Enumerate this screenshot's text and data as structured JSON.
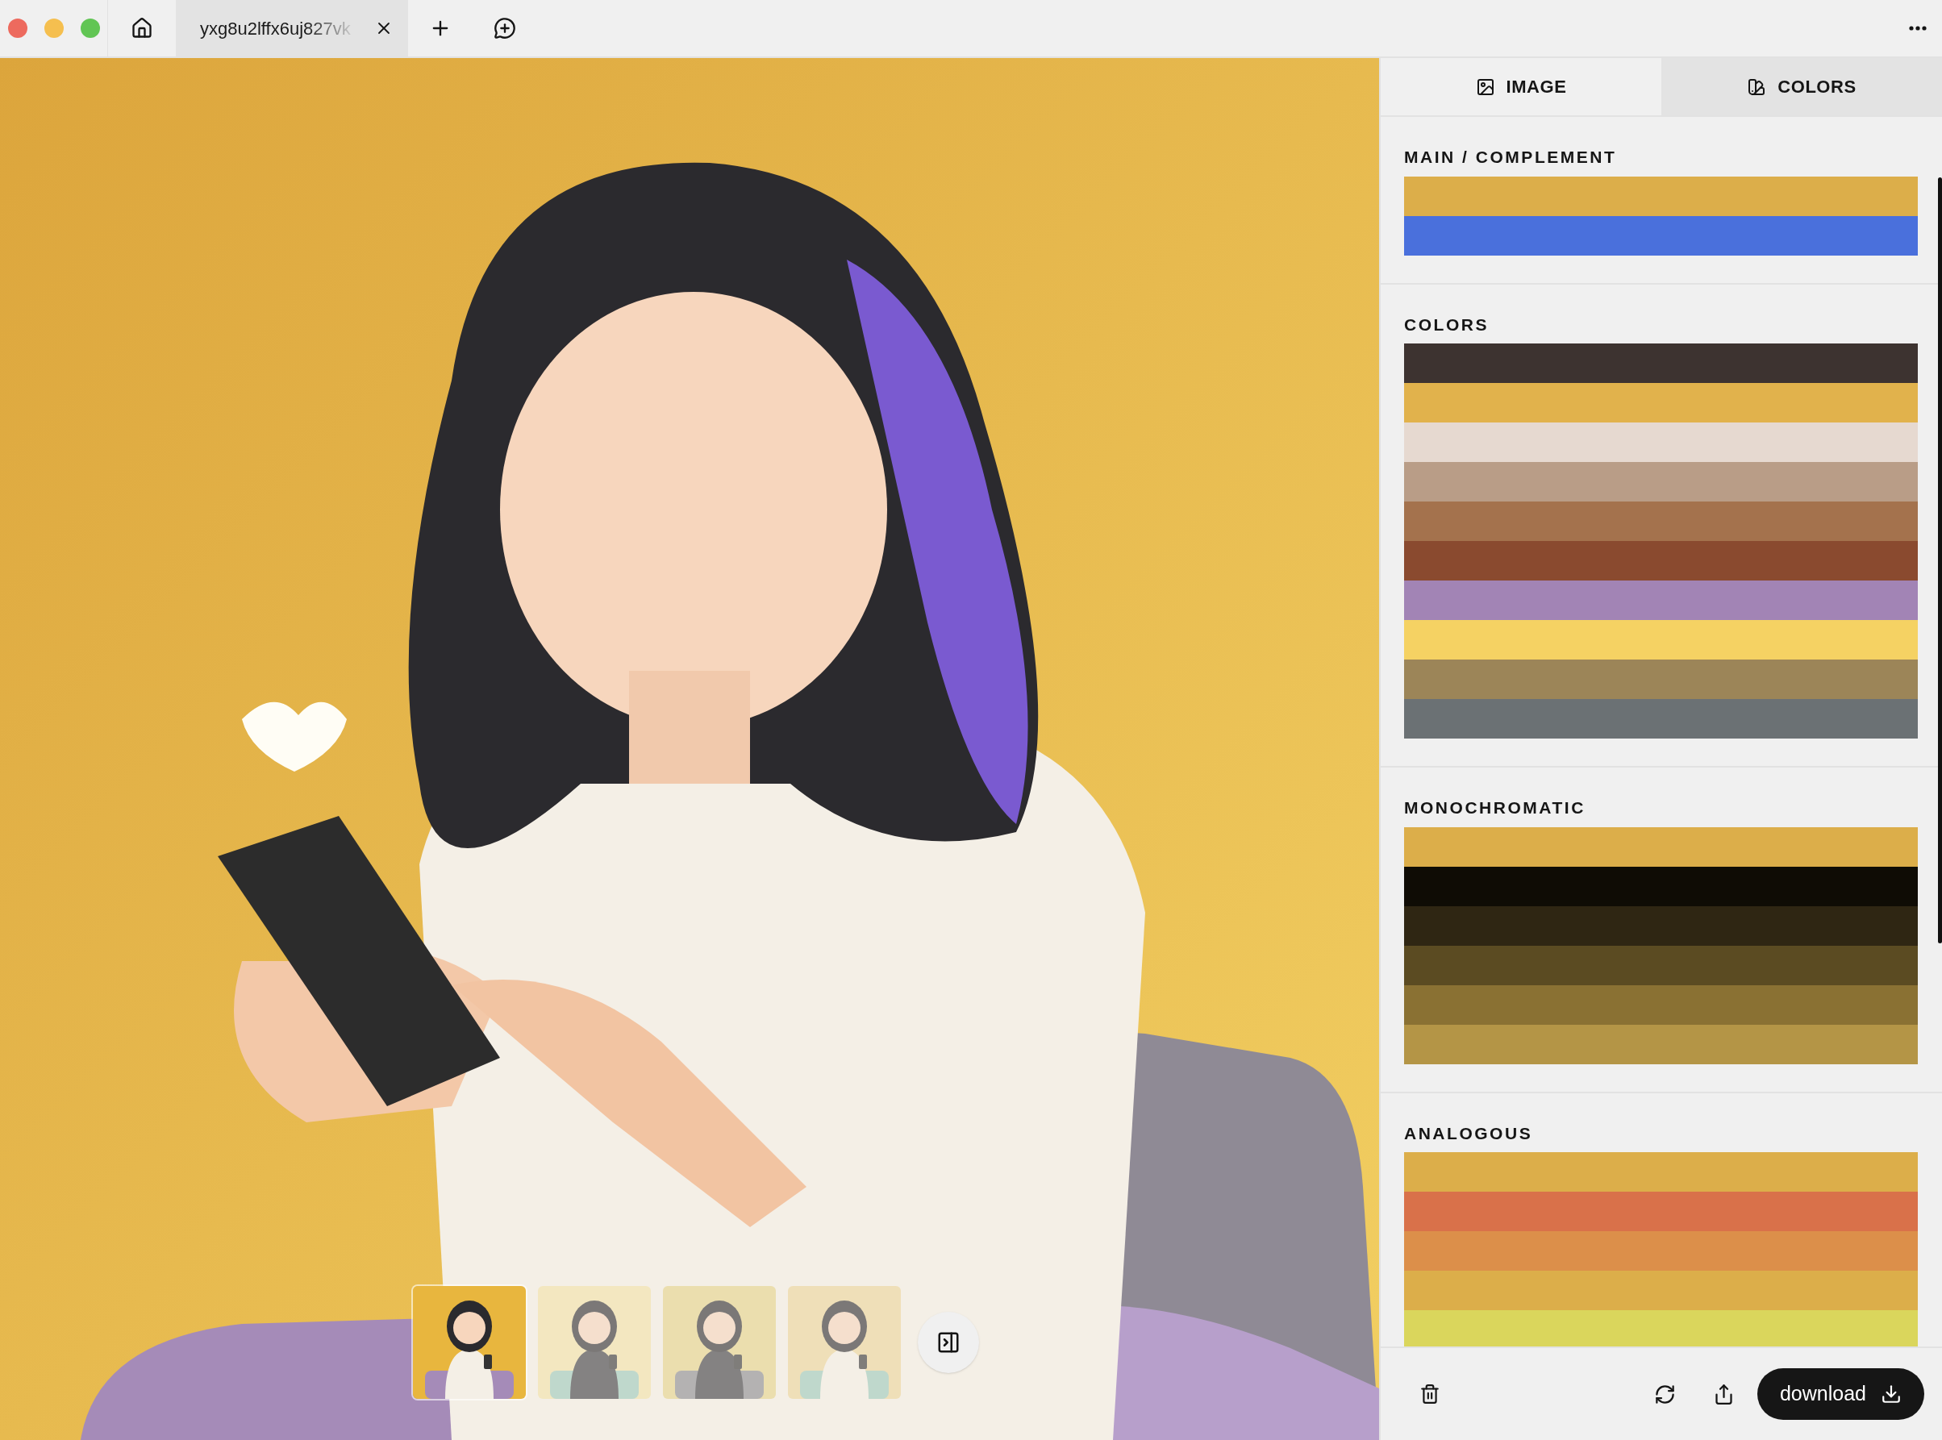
{
  "browser_tab": {
    "title": "yxg8u2lffx6uj827vk"
  },
  "thumbnails": [
    {
      "selected": true
    },
    {
      "selected": false
    },
    {
      "selected": false
    },
    {
      "selected": false
    }
  ],
  "panel_tabs": [
    {
      "label": "IMAGE",
      "selected": false
    },
    {
      "label": "COLORS",
      "selected": true
    }
  ],
  "sections": [
    {
      "title": "MAIN / COMPLEMENT",
      "swatches": [
        {
          "color": "#dcae4a"
        },
        {
          "color": "#4a70dc"
        }
      ]
    },
    {
      "title": "COLORS",
      "swatches": [
        {
          "color": "#3d3330"
        },
        {
          "color": "#e1b24c"
        },
        {
          "color": "#e6d9d0"
        },
        {
          "color": "#b99d87"
        },
        {
          "color": "#a4724d"
        },
        {
          "color": "#8a4a2f"
        },
        {
          "color": "#a284b5"
        },
        {
          "color": "#f5d263"
        },
        {
          "color": "#9c8558"
        },
        {
          "color": "#6b7174"
        }
      ]
    },
    {
      "title": "MONOCHROMATIC",
      "swatches": [
        {
          "color": "#dcae4a"
        },
        {
          "color": "#0f0c05"
        },
        {
          "color": "#2f2613"
        },
        {
          "color": "#5b4b22"
        },
        {
          "color": "#8a7133"
        },
        {
          "color": "#b49546"
        }
      ]
    },
    {
      "title": "ANALOGOUS",
      "swatches": [
        {
          "color": "#dcae4a"
        },
        {
          "color": "#d9714a"
        },
        {
          "color": "#dc8f4a"
        },
        {
          "color": "#dcae4a"
        },
        {
          "color": "#dad65c"
        }
      ]
    }
  ],
  "download_button": {
    "label": "download"
  }
}
